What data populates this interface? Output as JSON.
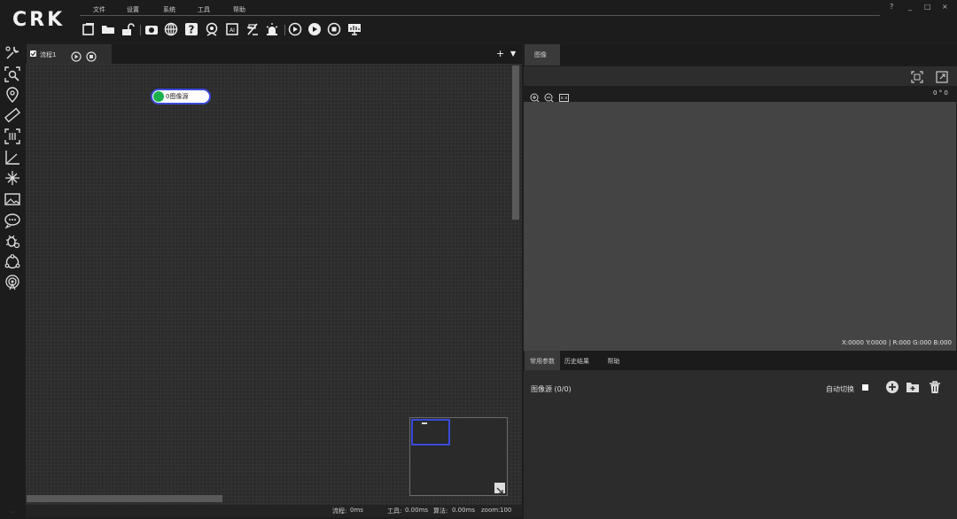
{
  "app": {
    "logo": "CRK"
  },
  "menu": {
    "items": [
      {
        "label": "文件"
      },
      {
        "label": "设置"
      },
      {
        "label": "系统"
      },
      {
        "label": "工具"
      },
      {
        "label": "帮助"
      }
    ]
  },
  "window_controls": {
    "help": "?",
    "minimize": "_",
    "maximize": "□",
    "close": "×"
  },
  "toolbar": {
    "icons": [
      "new-solution-icon",
      "open-folder-icon",
      "unlock-icon",
      "camera-icon",
      "globe-icon",
      "help-icon",
      "camera-settings-icon",
      "ai-icon",
      "scan-icon",
      "alarm-icon",
      "run-once-icon",
      "run-loop-icon",
      "stop-icon",
      "monitor-icon"
    ]
  },
  "left_rail": {
    "icons": [
      "tools-icon",
      "search-region-icon",
      "location-pin-icon",
      "ruler-icon",
      "code-scan-icon",
      "coordinate-icon",
      "calibrate-icon",
      "image-icon",
      "communication-icon",
      "bug-icon",
      "logic-cycle-icon",
      "signal-icon"
    ]
  },
  "flow": {
    "tab_label": "流程1",
    "tab_checked": true,
    "add_label": "+",
    "menu_label": "▼",
    "node": {
      "label": "0图像源",
      "status_color": "#1bb04c"
    },
    "status": {
      "flow_label": "流程:",
      "flow_value": "0ms",
      "tool_label": "工具:",
      "tool_value": "0.00ms",
      "algo_label": "算法:",
      "algo_value": "0.00ms",
      "zoom_label": "zoom:",
      "zoom_value": "100"
    }
  },
  "image_panel": {
    "tab_label": "图像",
    "angle_readout": "0 ° 0",
    "pixel_info": "X:0000  Y:0000 | R:000 G:000 B:000"
  },
  "bottom_panel": {
    "tabs": [
      {
        "label": "常用参数",
        "active": true
      },
      {
        "label": "历史结果",
        "active": false
      },
      {
        "label": "帮助",
        "active": false
      }
    ],
    "source_label": "图像源 (0/0)",
    "auto_switch_label": "自动切换",
    "auto_switch_checked": true
  },
  "colors": {
    "accent": "#3a4ad8",
    "node_status": "#1bb04c",
    "background": "#1e1e1e"
  }
}
